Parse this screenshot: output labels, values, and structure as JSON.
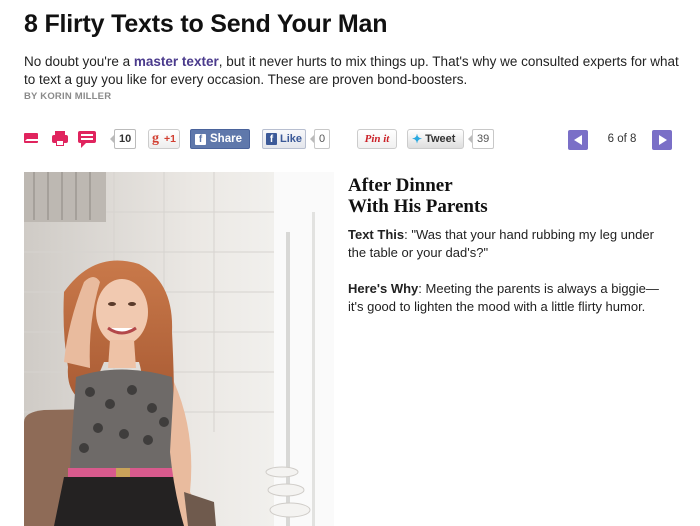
{
  "article": {
    "headline": "8 Flirty Texts to Send Your Man",
    "dek_before": "No doubt you're a ",
    "dek_link": "master texter",
    "dek_after": ", but it never hurts to mix things up. That's why we consulted experts for what to text a guy you like for every occasion. These are proven bond-boosters.",
    "byline": "BY KORIN MILLER"
  },
  "share": {
    "comment_count": "10",
    "gplus_label": "+1",
    "gplus_glyph": "g",
    "fb_share_label": "Share",
    "fb_like_label": "Like",
    "fb_like_count": "0",
    "fb_glyph": "f",
    "pin_label": "Pin it",
    "tweet_label": "Tweet",
    "tweet_count": "39"
  },
  "pager": {
    "label": "6 of 8"
  },
  "slide": {
    "title_line1": "After Dinner",
    "title_line2": "With His Parents",
    "text_label": "Text This",
    "text_body": ": \"Was that your hand rubbing my leg under the table or your dad's?\"",
    "why_label": "Here's Why",
    "why_body": ": Meeting the parents is always a biggie—it's good to lighten the mood with a little flirty humor."
  },
  "colors": {
    "accent_pink": "#e0245e",
    "pager_purple": "#7a6fc7",
    "link_purple": "#4a3a8c",
    "facebook_blue": "#5f78ab"
  }
}
